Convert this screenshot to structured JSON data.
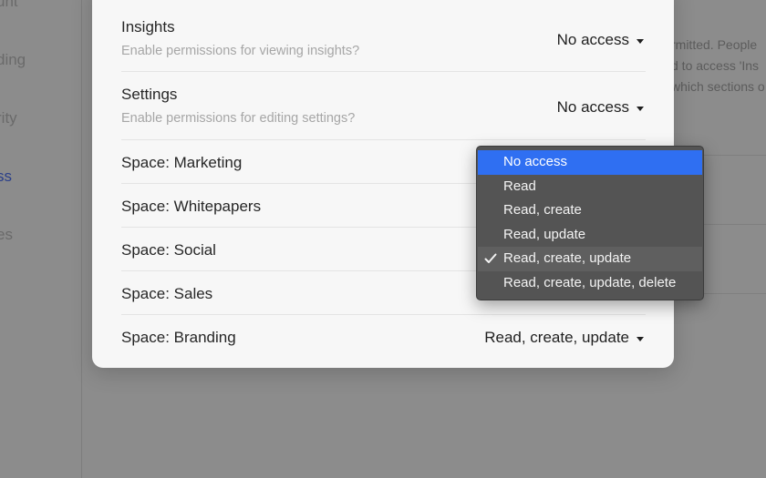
{
  "background": {
    "sidebar": [
      "unt",
      "ding",
      "rity",
      "ss",
      "es"
    ],
    "sidebar_active_index": 3,
    "right_text": [
      "rmitted. People",
      "d to access 'Ins",
      "which sections o"
    ]
  },
  "modal": {
    "rows": [
      {
        "title": "Insights",
        "description": "Enable permissions for viewing insights?",
        "value": "No access"
      },
      {
        "title": "Settings",
        "description": "Enable permissions for editing settings?",
        "value": "No access"
      },
      {
        "title": "Space: Marketing",
        "description": "",
        "value": ""
      },
      {
        "title": "Space: Whitepapers",
        "description": "",
        "value": ""
      },
      {
        "title": "Space: Social",
        "description": "",
        "value": ""
      },
      {
        "title": "Space: Sales",
        "description": "",
        "value": ""
      },
      {
        "title": "Space: Branding",
        "description": "",
        "value": "Read, create, update"
      }
    ]
  },
  "menu": {
    "options": [
      {
        "label": "No access",
        "highlighted": true,
        "checked": false
      },
      {
        "label": "Read",
        "highlighted": false,
        "checked": false
      },
      {
        "label": "Read, create",
        "highlighted": false,
        "checked": false
      },
      {
        "label": "Read, update",
        "highlighted": false,
        "checked": false
      },
      {
        "label": "Read, create, update",
        "highlighted": false,
        "checked": true
      },
      {
        "label": "Read, create, update, delete",
        "highlighted": false,
        "checked": false
      }
    ],
    "highlight_color": "#2F6FF2",
    "check_icon": "checkmark-icon"
  }
}
